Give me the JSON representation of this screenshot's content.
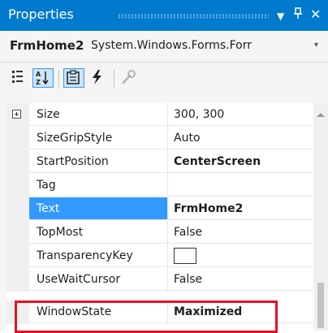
{
  "window": {
    "title": "Properties",
    "dropdown_glyph": "▼",
    "pin_glyph": "ᵠ",
    "close_glyph": "✕"
  },
  "selector": {
    "object_name": "FrmHome2",
    "object_type": "System.Windows.Forms.Forr",
    "arrow_glyph": "▾"
  },
  "toolbar": {
    "buttons": [
      {
        "name": "categorized-icon",
        "pressed": false
      },
      {
        "name": "alphabetical-icon",
        "pressed": true
      },
      {
        "name": "properties-icon",
        "pressed": true
      },
      {
        "name": "events-lightning-icon",
        "pressed": false
      },
      {
        "name": "property-pages-wrench-icon",
        "pressed": false
      }
    ]
  },
  "grid": {
    "rows": [
      {
        "name": "Size",
        "value": "300, 300",
        "bold": false,
        "expandable": true
      },
      {
        "name": "SizeGripStyle",
        "value": "Auto",
        "bold": false
      },
      {
        "name": "StartPosition",
        "value": "CenterScreen",
        "bold": true
      },
      {
        "name": "Tag",
        "value": "",
        "bold": false
      },
      {
        "name": "Text",
        "value": "FrmHome2",
        "bold": true,
        "selected": true
      },
      {
        "name": "TopMost",
        "value": "False",
        "bold": false
      },
      {
        "name": "TransparencyKey",
        "value": "",
        "bold": false,
        "color_swatch": "#ffffff"
      },
      {
        "name": "UseWaitCursor",
        "value": "False",
        "bold": false
      },
      {
        "name": "WindowState",
        "value": "Maximized",
        "bold": true
      }
    ]
  },
  "colors": {
    "title_bar": "#007acc",
    "selection": "#3399ff",
    "highlight_box": "#e81123"
  }
}
